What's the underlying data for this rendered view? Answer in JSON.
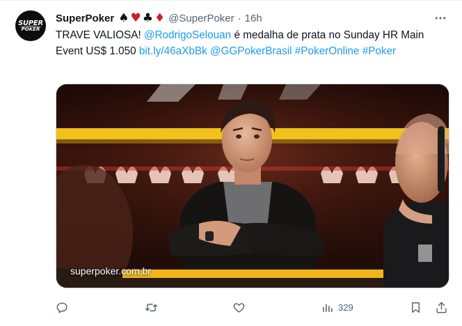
{
  "author": {
    "name": "SuperPoker",
    "handle": "@SuperPoker",
    "separator": "·",
    "time": "16h",
    "avatar_text_top": "SUPER",
    "avatar_text_bottom": "POKER",
    "name_suits": [
      "♠",
      "♥",
      "♣",
      "♦"
    ]
  },
  "tweet": {
    "text_plain_1": "TRAVE VALIOSA! ",
    "mention_player": "@RodrigoSelouan",
    "text_plain_2": " é medalha de prata no Sunday HR Main Event US$ 1.050 ",
    "link": "bit.ly/46aXbBk",
    "text_space_1": " ",
    "mention_brand": "@GGPokerBrasil",
    "text_space_2": " ",
    "hashtag_1": "#PokerOnline",
    "text_space_3": " ",
    "hashtag_2": "#Poker"
  },
  "media": {
    "watermark": "superpoker.com.br"
  },
  "actions": {
    "reply_icon": "reply-icon",
    "retweet_icon": "retweet-icon",
    "like_icon": "like-icon",
    "views_icon": "views-icon",
    "views_count": "329",
    "bookmark_icon": "bookmark-icon",
    "share_icon": "share-icon"
  },
  "colors": {
    "link": "#1d9bf0",
    "muted": "#536471",
    "text": "#0f1419",
    "suit_red": "#c9202f"
  }
}
